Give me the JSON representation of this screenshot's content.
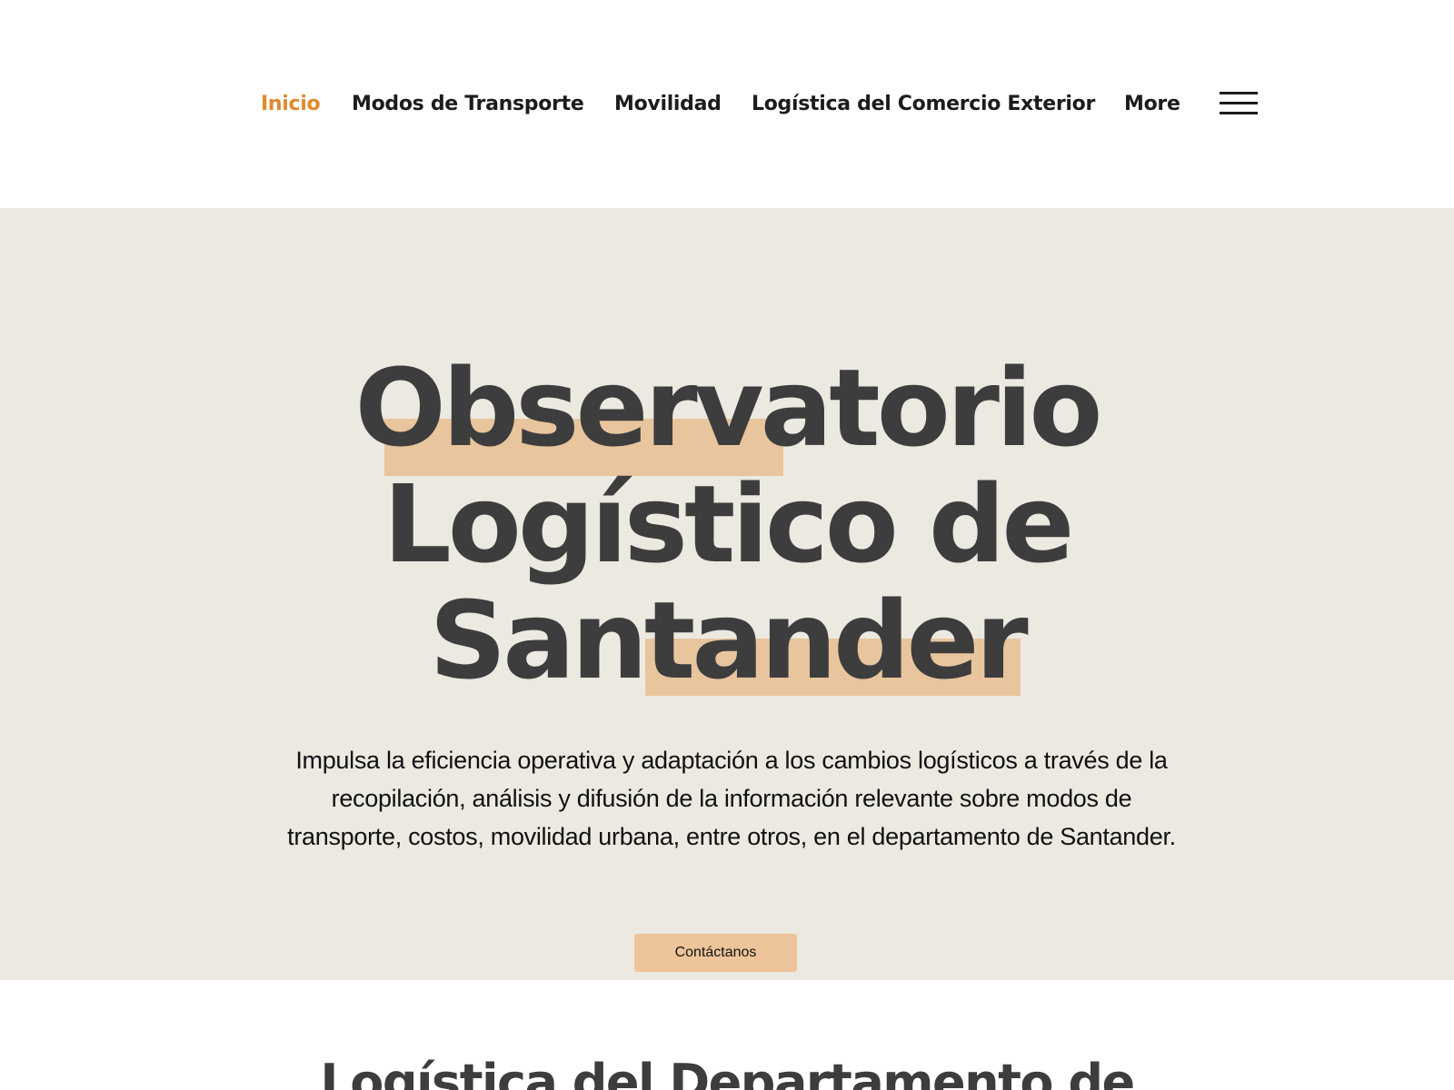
{
  "nav": {
    "items": [
      {
        "label": "Inicio",
        "active": true
      },
      {
        "label": "Modos de Transporte",
        "active": false
      },
      {
        "label": "Movilidad",
        "active": false
      },
      {
        "label": "Logística del Comercio Exterior",
        "active": false
      },
      {
        "label": "More",
        "active": false
      }
    ],
    "menu_icon": "hamburger-menu-icon",
    "active_color": "#e08a2e"
  },
  "hero": {
    "title_lines": [
      "Observatorio",
      "Logístico de",
      "Santander"
    ],
    "description": "Impulsa la eficiencia operativa y adaptación a los cambios logísticos a través de la recopilación, análisis y difusión de la información relevante sobre modos de transporte, costos, movilidad urbana, entre otros, en el departamento de Santander.",
    "cta_label": "Contáctanos",
    "background_color": "#ece9e1",
    "highlight_color": "#e9c59e"
  },
  "section2": {
    "title": "Logística del Departamento de"
  }
}
